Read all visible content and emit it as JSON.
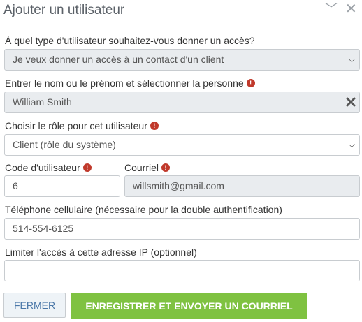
{
  "dialog": {
    "title": "Ajouter un utilisateur",
    "minimize_icon": "minimize-icon",
    "close_icon": "close-icon"
  },
  "form": {
    "user_type": {
      "label": "À quel type d'utilisateur souhaitez-vous donner un accès?",
      "value": "Je veux donner un accès à un contact d'un client"
    },
    "person": {
      "label": "Entrer le nom ou le prénom et sélectionner la personne",
      "value": "William Smith"
    },
    "role": {
      "label": "Choisir le rôle pour cet utilisateur",
      "value": "Client (rôle du système)"
    },
    "user_code": {
      "label": "Code d'utilisateur",
      "value": "6"
    },
    "email": {
      "label": "Courriel",
      "value": "willsmith@gmail.com"
    },
    "phone": {
      "label": "Téléphone cellulaire (nécessaire pour la double authentification)",
      "value": "514-554-6125"
    },
    "ip": {
      "label": "Limiter l'accès à cette adresse IP (optionnel)",
      "value": ""
    },
    "required_mark": "!"
  },
  "actions": {
    "close_label": "FERMER",
    "save_label": "ENREGISTRER ET ENVOYER UN COURRIEL"
  },
  "colors": {
    "primary_green": "#7fc241",
    "required_red": "#c0392b",
    "close_text": "#4a77a8"
  }
}
